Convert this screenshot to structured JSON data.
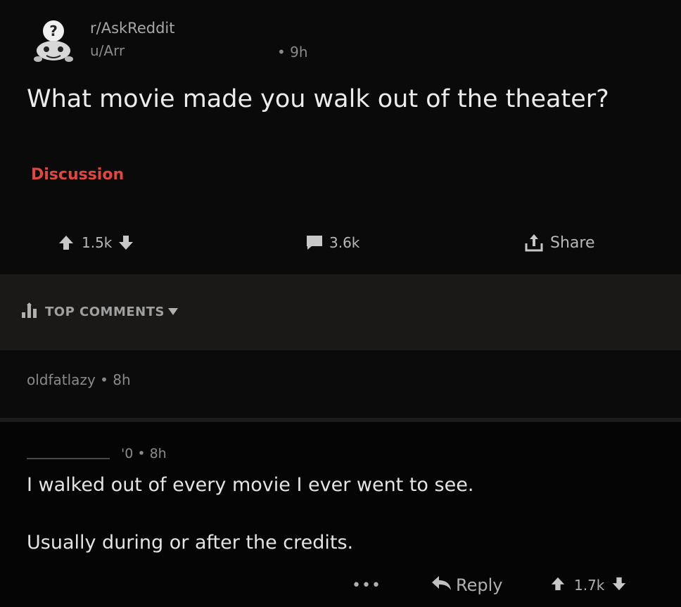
{
  "post": {
    "subreddit": "r/AskReddit",
    "author": "u/Arr",
    "time": "• 9h",
    "title": "What movie made you walk out of the theater?",
    "flair": "Discussion",
    "upvotes": "1.5k",
    "comments": "3.6k",
    "share_label": "Share"
  },
  "sort": {
    "label": "TOP COMMENTS"
  },
  "comments": [
    {
      "meta": "oldfatlazy • 8h"
    },
    {
      "meta": "'0 • 8h",
      "body_line1": "I walked out of every movie I ever went to see.",
      "body_line2": "Usually during or after the credits.",
      "more_label": "•••",
      "reply_label": "Reply",
      "votes": "1.7k"
    }
  ],
  "icons": {
    "avatar": "snoo-question-avatar-icon",
    "upvote": "arrow-up-icon",
    "downvote": "arrow-down-icon",
    "comment": "speech-bubble-icon",
    "share": "share-upload-icon",
    "sort": "bar-chart-sort-icon",
    "caret": "caret-down-icon",
    "reply": "reply-arrow-icon"
  },
  "colors": {
    "flair": "#e0473f",
    "background": "#000000",
    "sort_bar": "#1b1917"
  }
}
